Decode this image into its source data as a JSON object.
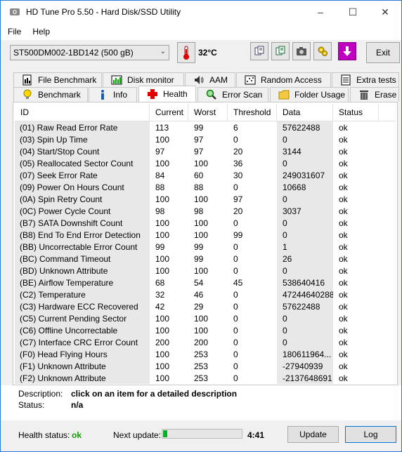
{
  "window": {
    "title": "HD Tune Pro 5.50 - Hard Disk/SSD Utility"
  },
  "menu": {
    "file": "File",
    "help": "Help"
  },
  "toolbar": {
    "drive": "ST500DM002-1BD142 (500 gB)",
    "temperature": "32°C",
    "exit_label": "Exit"
  },
  "tabs": {
    "row1": [
      "File Benchmark",
      "Disk monitor",
      "AAM",
      "Random Access",
      "Extra tests"
    ],
    "row2": [
      "Benchmark",
      "Info",
      "Health",
      "Error Scan",
      "Folder Usage",
      "Erase"
    ],
    "active": "Health"
  },
  "table": {
    "columns": [
      "ID",
      "Current",
      "Worst",
      "Threshold",
      "Data",
      "Status"
    ],
    "rows": [
      [
        "(01) Raw Read Error Rate",
        "113",
        "99",
        "6",
        "57622488",
        "ok"
      ],
      [
        "(03) Spin Up Time",
        "100",
        "97",
        "0",
        "0",
        "ok"
      ],
      [
        "(04) Start/Stop Count",
        "97",
        "97",
        "20",
        "3144",
        "ok"
      ],
      [
        "(05) Reallocated Sector Count",
        "100",
        "100",
        "36",
        "0",
        "ok"
      ],
      [
        "(07) Seek Error Rate",
        "84",
        "60",
        "30",
        "249031607",
        "ok"
      ],
      [
        "(09) Power On Hours Count",
        "88",
        "88",
        "0",
        "10668",
        "ok"
      ],
      [
        "(0A) Spin Retry Count",
        "100",
        "100",
        "97",
        "0",
        "ok"
      ],
      [
        "(0C) Power Cycle Count",
        "98",
        "98",
        "20",
        "3037",
        "ok"
      ],
      [
        "(B7) SATA Downshift Count",
        "100",
        "100",
        "0",
        "0",
        "ok"
      ],
      [
        "(B8) End To End Error Detection",
        "100",
        "100",
        "99",
        "0",
        "ok"
      ],
      [
        "(BB) Uncorrectable Error Count",
        "99",
        "99",
        "0",
        "1",
        "ok"
      ],
      [
        "(BC) Command Timeout",
        "100",
        "99",
        "0",
        "26",
        "ok"
      ],
      [
        "(BD) Unknown Attribute",
        "100",
        "100",
        "0",
        "0",
        "ok"
      ],
      [
        "(BE) Airflow Temperature",
        "68",
        "54",
        "45",
        "538640416",
        "ok"
      ],
      [
        "(C2) Temperature",
        "32",
        "46",
        "0",
        "47244640288",
        "ok"
      ],
      [
        "(C3) Hardware ECC Recovered",
        "42",
        "29",
        "0",
        "57622488",
        "ok"
      ],
      [
        "(C5) Current Pending Sector",
        "100",
        "100",
        "0",
        "0",
        "ok"
      ],
      [
        "(C6) Offline Uncorrectable",
        "100",
        "100",
        "0",
        "0",
        "ok"
      ],
      [
        "(C7) Interface CRC Error Count",
        "200",
        "200",
        "0",
        "0",
        "ok"
      ],
      [
        "(F0) Head Flying Hours",
        "100",
        "253",
        "0",
        "180611964...",
        "ok"
      ],
      [
        "(F1) Unknown Attribute",
        "100",
        "253",
        "0",
        "-27940939",
        "ok"
      ],
      [
        "(F2) Unknown Attribute",
        "100",
        "253",
        "0",
        "-2137648691",
        "ok"
      ]
    ]
  },
  "description": {
    "desc_label": "Description:",
    "desc_value": "click on an item for a detailed description",
    "status_label": "Status:",
    "status_value": "n/a"
  },
  "status": {
    "health_label": "Health status:",
    "health_value": "ok",
    "health_color": "#10a000",
    "next_update_label": "Next update:",
    "next_update_progress": 0.05,
    "next_update_time": "4:41",
    "update_label": "Update",
    "log_label": "Log"
  },
  "colors": {
    "progress": "#06b025",
    "window_border": "#2b7bd6"
  }
}
